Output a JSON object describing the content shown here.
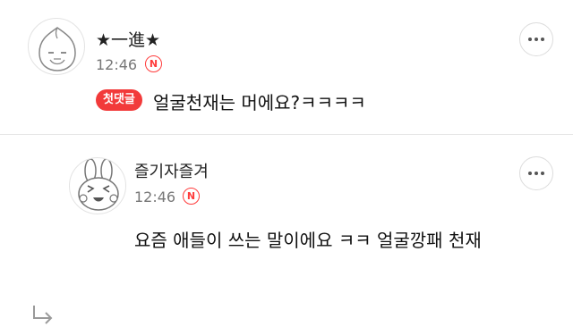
{
  "comments": [
    {
      "author": "★一進★",
      "time": "12:46",
      "time_badge": "N",
      "first_badge": "첫댓글",
      "text": "얼굴천재는 머에요?ㅋㅋㅋㅋ"
    },
    {
      "author": "즐기자즐겨",
      "time": "12:46",
      "time_badge": "N",
      "text": "요즘 애들이 쓰는 말이에요 ㅋㅋ 얼굴깡패 천재"
    }
  ],
  "colors": {
    "accent": "#f23a3a",
    "badge_outline": "#ff3b3b",
    "muted": "#777777"
  },
  "icons": {
    "more": "more-dots-icon",
    "reply": "reply-arrow-icon"
  }
}
